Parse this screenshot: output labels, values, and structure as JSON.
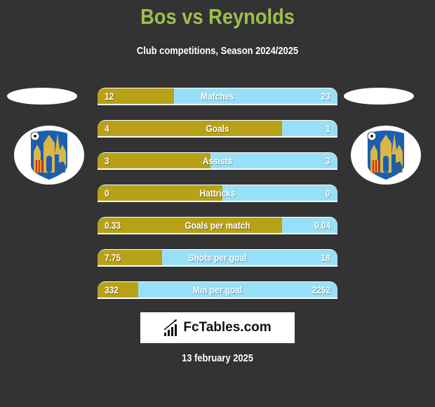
{
  "header": {
    "title": "Bos vs Reynolds",
    "subtitle": "Club competitions, Season 2024/2025"
  },
  "colors": {
    "background": "#333333",
    "title": "#9ebf4a",
    "left_bar": "#b8a117",
    "right_bar": "#98e0f8"
  },
  "teams": {
    "left": {
      "player": "Bos",
      "crest_icon": "club-crest-icon"
    },
    "right": {
      "player": "Reynolds",
      "crest_icon": "club-crest-icon"
    }
  },
  "stats": [
    {
      "label": "Matches",
      "left": "12",
      "right": "23",
      "left_share": 0.32
    },
    {
      "label": "Goals",
      "left": "4",
      "right": "1",
      "left_share": 0.77
    },
    {
      "label": "Assists",
      "left": "3",
      "right": "3",
      "left_share": 0.47
    },
    {
      "label": "Hattricks",
      "left": "0",
      "right": "0",
      "left_share": 0.52
    },
    {
      "label": "Goals per match",
      "left": "0.33",
      "right": "0.04",
      "left_share": 0.77
    },
    {
      "label": "Shots per goal",
      "left": "7.75",
      "right": "18",
      "left_share": 0.27
    },
    {
      "label": "Min per goal",
      "left": "332",
      "right": "2252",
      "left_share": 0.17
    }
  ],
  "brand": {
    "name": "FcTables.com",
    "icon": "bar-chart-icon"
  },
  "footer": {
    "date": "13 february 2025"
  }
}
